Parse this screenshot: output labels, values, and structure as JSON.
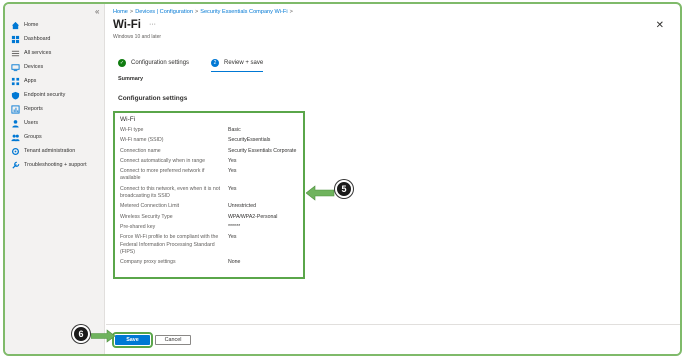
{
  "sidebar": {
    "collapse_glyph": "«",
    "items": [
      {
        "label": "Home",
        "icon": "home-icon",
        "color": "#0078d4"
      },
      {
        "label": "Dashboard",
        "icon": "dashboard-icon",
        "color": "#0078d4"
      },
      {
        "label": "All services",
        "icon": "all-services-icon",
        "color": "#605e5c"
      },
      {
        "label": "Devices",
        "icon": "devices-icon",
        "color": "#0078d4"
      },
      {
        "label": "Apps",
        "icon": "apps-icon",
        "color": "#0078d4"
      },
      {
        "label": "Endpoint security",
        "icon": "shield-icon",
        "color": "#0078d4"
      },
      {
        "label": "Reports",
        "icon": "reports-icon",
        "color": "#0078d4"
      },
      {
        "label": "Users",
        "icon": "users-icon",
        "color": "#0078d4"
      },
      {
        "label": "Groups",
        "icon": "groups-icon",
        "color": "#0078d4"
      },
      {
        "label": "Tenant administration",
        "icon": "tenant-admin-icon",
        "color": "#0078d4"
      },
      {
        "label": "Troubleshooting + support",
        "icon": "troubleshooting-icon",
        "color": "#0078d4"
      }
    ]
  },
  "breadcrumb": {
    "items": [
      "Home",
      "Devices | Configuration",
      "Security Essentials Company Wi-Fi"
    ],
    "separator": ">"
  },
  "header": {
    "title": "Wi-Fi",
    "more": "···",
    "subtitle": "Windows 10 and later",
    "close": "✕"
  },
  "tabs": [
    {
      "label": "Configuration settings",
      "badge": "✓",
      "badge_color": "#107c10"
    },
    {
      "label": "Review + save",
      "badge": "2",
      "badge_color": "#0078d4"
    }
  ],
  "summary_label": "Summary",
  "section_heading": "Configuration settings",
  "wifi_card": {
    "title": "Wi-Fi",
    "rows": [
      {
        "key": "Wi-Fi type",
        "value": "Basic"
      },
      {
        "key": "Wi-Fi name (SSID)",
        "value": "SecurityEssentials"
      },
      {
        "key": "Connection name",
        "value": "Security Essentials Corporate"
      },
      {
        "key": "Connect automatically when in range",
        "value": "Yes"
      },
      {
        "key": "Connect to more preferred network if available",
        "value": "Yes"
      },
      {
        "key": "Connect to this network, even when it is not broadcasting its SSID",
        "value": "Yes"
      },
      {
        "key": "Metered Connection Limit",
        "value": "Unrestricted"
      },
      {
        "key": "Wireless Security Type",
        "value": "WPA/WPA2-Personal"
      },
      {
        "key": "Pre-shared key",
        "value": "******"
      },
      {
        "key": "Force Wi-Fi profile to be compliant with the Federal Information Processing Standard (FIPS)",
        "value": "Yes"
      },
      {
        "key": "Company proxy settings",
        "value": "None"
      }
    ]
  },
  "callouts": {
    "card": "5",
    "save": "6"
  },
  "footer": {
    "save_label": "Save",
    "cancel_label": "Cancel"
  },
  "colors": {
    "accent": "#0078d4",
    "highlight": "#5aa64a"
  }
}
